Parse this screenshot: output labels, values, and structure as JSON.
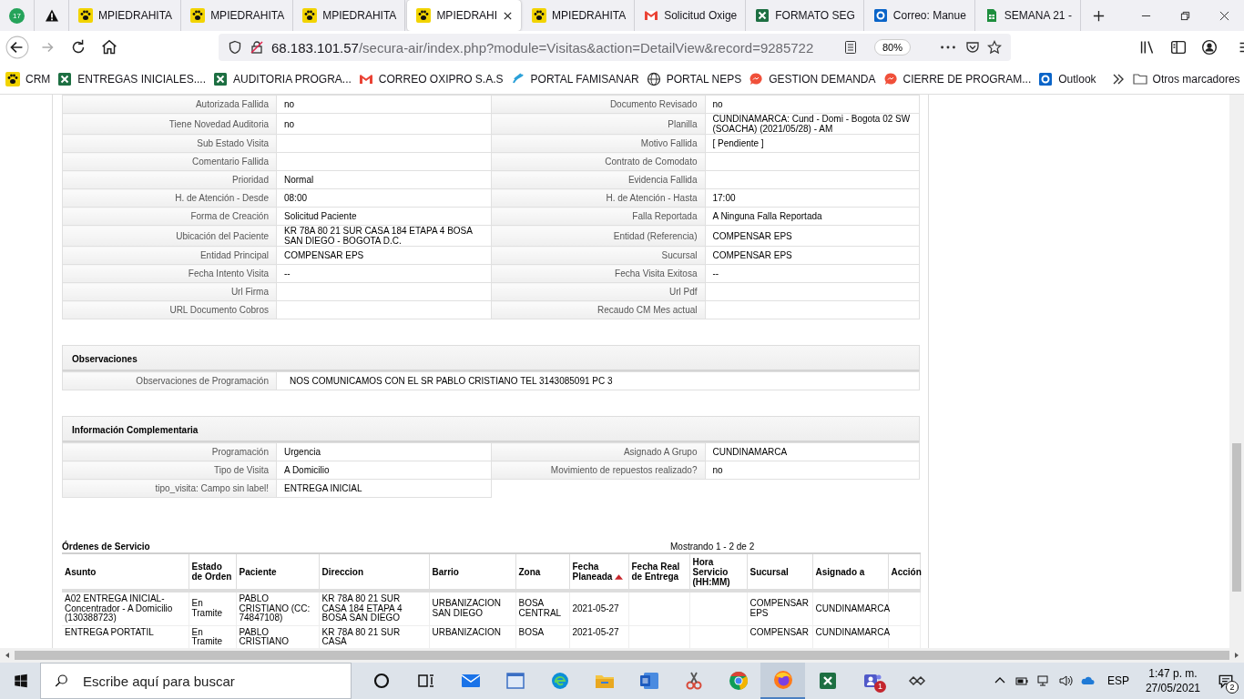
{
  "browser": {
    "tabs": [
      {
        "kind": "whatsapp",
        "badge": "17",
        "selected": false
      },
      {
        "kind": "warning",
        "selected": false
      },
      {
        "kind": "paw",
        "label": "MPIEDRAHITA",
        "selected": false
      },
      {
        "kind": "paw",
        "label": "MPIEDRAHITA",
        "selected": false
      },
      {
        "kind": "paw",
        "label": "MPIEDRAHITA",
        "selected": false
      },
      {
        "kind": "paw",
        "label": "MPIEDRAHI",
        "selected": true
      },
      {
        "kind": "paw",
        "label": "MPIEDRAHITA",
        "selected": false
      },
      {
        "kind": "gmail",
        "label": "Solicitud Oxige",
        "selected": false
      },
      {
        "kind": "excel",
        "label": "FORMATO SEG",
        "selected": false
      },
      {
        "kind": "outlook",
        "label": "Correo: Manue",
        "selected": false
      },
      {
        "kind": "sheets",
        "label": "SEMANA 21 -",
        "selected": false
      }
    ],
    "url": {
      "host": "68.183.101.57",
      "path": "/secura-air/index.php?module=Visitas&action=DetailView&record=9285722"
    },
    "zoom": "80%",
    "bookmarks": [
      {
        "kind": "paw",
        "label": "CRM"
      },
      {
        "kind": "excel",
        "label": "ENTREGAS INICIALES...."
      },
      {
        "kind": "excel",
        "label": "AUDITORIA PROGRA..."
      },
      {
        "kind": "gmail",
        "label": "CORREO OXIPRO S.A.S"
      },
      {
        "kind": "swirl",
        "label": "PORTAL FAMISANAR"
      },
      {
        "kind": "globe",
        "label": "PORTAL NEPS"
      },
      {
        "kind": "bubble",
        "label": "GESTION DEMANDA"
      },
      {
        "kind": "bubble",
        "label": "CIERRE DE PROGRAM..."
      },
      {
        "kind": "outlook",
        "label": "Outlook"
      }
    ],
    "other_bookmarks": "Otros marcadores"
  },
  "details": [
    {
      "left": {
        "label": "Autorizada Fallida",
        "value": "no"
      },
      "right": {
        "label": "Documento Revisado",
        "value": "no"
      }
    },
    {
      "left": {
        "label": "Tiene Novedad Auditoria",
        "value": "no"
      },
      "right": {
        "label": "Planilla",
        "value": "CUNDINAMARCA: Cund - Domi - Bogota 02 SW (SOACHA) (2021/05/28) - AM"
      }
    },
    {
      "left": {
        "label": "Sub Estado Visita"
      },
      "right": {
        "label": "Motivo Fallida",
        "value": "[ Pendiente ]"
      }
    },
    {
      "left": {
        "label": "Comentario Fallida"
      },
      "right": {
        "label": "Contrato de Comodato"
      }
    },
    {
      "left": {
        "label": "Prioridad",
        "value": "Normal"
      },
      "right": {
        "label": "Evidencia Fallida"
      }
    },
    {
      "left": {
        "label": "H. de Atención - Desde",
        "value": "08:00"
      },
      "right": {
        "label": "H. de Atención - Hasta",
        "value": "17:00"
      }
    },
    {
      "left": {
        "label": "Forma de Creación",
        "value": "Solicitud Paciente"
      },
      "right": {
        "label": "Falla Reportada",
        "value": "A Ninguna Falla Reportada"
      }
    },
    {
      "left": {
        "label": "Ubicación del Paciente",
        "value": "KR 78A 80 21 SUR CASA 184 ETAPA 4 BOSA SAN DIEGO - BOGOTA D.C."
      },
      "right": {
        "label": "Entidad (Referencia)",
        "value": "COMPENSAR EPS"
      }
    },
    {
      "left": {
        "label": "Entidad Principal",
        "value": "COMPENSAR EPS"
      },
      "right": {
        "label": "Sucursal",
        "value": "COMPENSAR EPS"
      }
    },
    {
      "left": {
        "label": "Fecha Intento Visita",
        "value": "--"
      },
      "right": {
        "label": "Fecha Visita Exitosa",
        "value": "--"
      }
    },
    {
      "left": {
        "label": "Url Firma"
      },
      "right": {
        "label": "Url Pdf"
      }
    },
    {
      "left": {
        "label": "URL Documento Cobros"
      },
      "right": {
        "label": "Recaudo CM Mes actual"
      }
    }
  ],
  "observaciones": {
    "title": "Observaciones",
    "rows": [
      {
        "label": "Observaciones de Programación",
        "value": "NOS COMUNICAMOS CON EL SR PABLO CRISTIANO TEL 3143085091 PC 3"
      }
    ]
  },
  "complementaria": {
    "title": "Información Complementaria",
    "rows": [
      {
        "left": {
          "label": "Programación",
          "value": "Urgencia"
        },
        "right": {
          "label": "Asignado A Grupo",
          "value": "CUNDINAMARCA"
        }
      },
      {
        "left": {
          "label": "Tipo de Visita",
          "value": "A Domicilio"
        },
        "right": {
          "label": "Movimiento de repuestos realizado?",
          "value": "no"
        }
      },
      {
        "left": {
          "label": "tipo_visita: Campo sin label!",
          "value": "ENTREGA INICIAL"
        }
      }
    ]
  },
  "orders": {
    "title": "Órdenes de Servicio",
    "count": "Mostrando 1 - 2 de 2",
    "columns": [
      {
        "label": "Asunto",
        "sorted": false
      },
      {
        "label": "Estado de Orden",
        "sorted": false
      },
      {
        "label": "Paciente",
        "sorted": false
      },
      {
        "label": "Direccion",
        "sorted": false
      },
      {
        "label": "Barrio",
        "sorted": false
      },
      {
        "label": "Zona",
        "sorted": false
      },
      {
        "label": "Fecha Planeada",
        "sorted": true
      },
      {
        "label": "Fecha Real de Entrega",
        "sorted": false
      },
      {
        "label": "Hora Servicio (HH:MM)",
        "sorted": false
      },
      {
        "label": "Sucursal",
        "sorted": false
      },
      {
        "label": "Asignado a",
        "sorted": false
      },
      {
        "label": "Acción",
        "sorted": false
      }
    ],
    "rows": [
      [
        "A02 ENTREGA INICIAL- Concentrador - A Domicilio (130388723)",
        "En Tramite",
        "PABLO CRISTIANO (CC: 74847108)",
        "KR 78A 80 21 SUR CASA 184 ETAPA 4 BOSA SAN DIEGO",
        "URBANIZACION SAN DIEGO",
        "BOSA CENTRAL",
        "2021-05-27",
        "",
        "",
        "COMPENSAR EPS",
        "CUNDINAMARCA",
        ""
      ],
      [
        "ENTREGA PORTATIL",
        "En Tramite",
        "PABLO CRISTIANO",
        "KR 78A 80 21 SUR CASA",
        "URBANIZACION",
        "BOSA",
        "2021-05-27",
        "",
        "",
        "COMPENSAR",
        "CUNDINAMARCA",
        ""
      ]
    ]
  },
  "taskbar": {
    "search_placeholder": "Escribe aquí para buscar",
    "apps": [
      {
        "kind": "cortana",
        "active": false
      },
      {
        "kind": "taskview",
        "active": false
      },
      {
        "kind": "mail",
        "active": false
      },
      {
        "kind": "window",
        "active": false
      },
      {
        "kind": "edge",
        "active": false
      },
      {
        "kind": "explorer",
        "active": false
      },
      {
        "kind": "word",
        "active": false
      },
      {
        "kind": "snip",
        "active": false
      },
      {
        "kind": "chrome",
        "active": false
      },
      {
        "kind": "firefox",
        "active": true
      },
      {
        "kind": "excel",
        "active": false
      },
      {
        "kind": "teams",
        "active": false,
        "badge": "1"
      },
      {
        "kind": "net",
        "active": false
      }
    ],
    "language": "ESP",
    "time": "1:47 p. m.",
    "date": "27/05/2021",
    "notifications": "2"
  }
}
